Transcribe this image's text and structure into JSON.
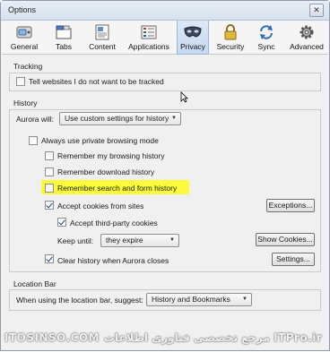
{
  "window": {
    "title": "Options",
    "close_glyph": "✕"
  },
  "toolbar": {
    "tabs": [
      {
        "label": "General",
        "icon": "general-switch-icon"
      },
      {
        "label": "Tabs",
        "icon": "tabs-window-icon"
      },
      {
        "label": "Content",
        "icon": "content-page-icon"
      },
      {
        "label": "Applications",
        "icon": "applications-list-icon"
      },
      {
        "label": "Privacy",
        "icon": "privacy-mask-icon",
        "selected": true
      },
      {
        "label": "Security",
        "icon": "padlock-icon"
      },
      {
        "label": "Sync",
        "icon": "sync-arrows-icon"
      },
      {
        "label": "Advanced",
        "icon": "gear-icon"
      }
    ]
  },
  "tracking": {
    "title": "Tracking",
    "dnt_label": "Tell websites I do not want to be tracked",
    "dnt_checked": false
  },
  "history": {
    "title": "History",
    "will_label": "Aurora will:",
    "will_value": "Use custom settings for history",
    "private_label": "Always use private browsing mode",
    "private_checked": false,
    "browsing_label": "Remember my browsing history",
    "browsing_checked": false,
    "download_label": "Remember download history",
    "download_checked": false,
    "search_label": "Remember search and form history",
    "search_checked": false,
    "cookies_label": "Accept cookies from sites",
    "cookies_checked": true,
    "exceptions_button": "Exceptions...",
    "third_party_label": "Accept third-party cookies",
    "third_party_checked": true,
    "keep_until_label": "Keep until:",
    "keep_until_value": "they expire",
    "show_cookies_button": "Show Cookies...",
    "clear_label": "Clear history when Aurora closes",
    "clear_checked": true,
    "settings_button": "Settings..."
  },
  "location_bar": {
    "title": "Location Bar",
    "suggest_label": "When using the location bar, suggest:",
    "suggest_value": "History and Bookmarks"
  },
  "watermark": {
    "text": "ITOSINSO.COM مرجع تخصصی فناوری اطلاعات ITPro.ir"
  },
  "colors": {
    "highlight": "#fbfb3c",
    "selected_tab": "#c6d8f1"
  }
}
